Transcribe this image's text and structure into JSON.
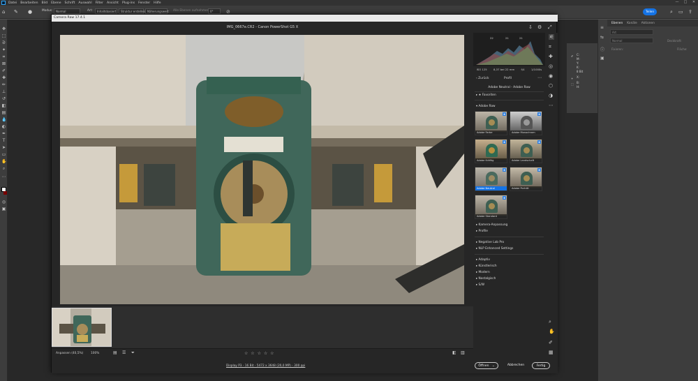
{
  "photoshop": {
    "menu": [
      "Datei",
      "Bearbeiten",
      "Bild",
      "Ebene",
      "Schrift",
      "Auswahl",
      "Filter",
      "Ansicht",
      "Plug-ins",
      "Fenster",
      "Hilfe"
    ],
    "window_controls": [
      "—",
      "□",
      "✕"
    ],
    "options": {
      "modus_label": "Modus:",
      "modus_value": "Normal",
      "art_label": "Art:",
      "art_opt1": "Inhaltsbasiert",
      "art_opt2": "Struktur erstellen",
      "art_opt3": "Näherungswert",
      "sample_all": "Alle Ebenen aufnehmen",
      "angle": "0°",
      "share_label": "Teilen"
    },
    "panel_tabs": [
      "Ebenen",
      "Kanäle",
      "Aktionen"
    ],
    "layers": {
      "search_placeholder": "Art",
      "blend": "Normal",
      "opacity_label": "Deckkraft:",
      "lock_label": "Fixieren:",
      "fill_label": "Fläche:"
    },
    "props": {
      "c": "C:",
      "m": "M:",
      "y": "Y:",
      "k": "K:",
      "x": "X:",
      "xy": "8 Bit",
      "w": "B:",
      "h": "H:"
    }
  },
  "camera_raw": {
    "window_title": "Camera Raw 17.4.1",
    "file_title": "IMG_0667e.CR2  -  Canon PowerShot G5 X",
    "camera_info": {
      "iso": "ISO 125",
      "focal": "8,37 bei 22 mm",
      "aperture": "f/4",
      "shutter": "1/1000s"
    },
    "histogram_values": {
      "r": "22",
      "g": "21",
      "b": "21"
    },
    "profile": {
      "back_label": "Zurück",
      "panel_title": "Profil",
      "current": "Adobe Neutral - Adobe Raw",
      "favorites": "Favoriten",
      "adobe_raw": "Adobe Raw",
      "tiles": [
        {
          "label": "Adobe Farbe",
          "starred": true,
          "selected": false
        },
        {
          "label": "Adobe Monochrom",
          "starred": true,
          "selected": false
        },
        {
          "label": "Adobe Kräftig",
          "starred": true,
          "selected": false
        },
        {
          "label": "Adobe Landschaft",
          "starred": true,
          "selected": false
        },
        {
          "label": "Adobe Neutral",
          "starred": true,
          "selected": true
        },
        {
          "label": "Adobe Porträt",
          "starred": true,
          "selected": false
        },
        {
          "label": "Adobe Standard",
          "starred": true,
          "selected": false
        }
      ],
      "groups_a": [
        "Kamera-Anpassung",
        "Profile"
      ],
      "groups_b": [
        "Negative Lab Pro",
        "NLP Enhanced Settings"
      ],
      "groups_c": [
        "Adaptiv",
        "Künstlerisch",
        "Modern",
        "Nostalgisch",
        "S/W"
      ]
    },
    "zoom_fit": "Anpassen (40,5%)",
    "zoom_pct": "100%",
    "stars": "☆ ☆ ☆ ☆ ☆",
    "display_link": "Display P3 - 16 Bit - 5472 x 3648 (20,0 MP) - 300 ppi",
    "open_label": "Öffnen",
    "cancel_label": "Abbrechen",
    "done_label": "Fertig"
  },
  "colors": {
    "accent": "#1473e6",
    "panel": "#262626",
    "chrome": "#3d3d3d"
  }
}
